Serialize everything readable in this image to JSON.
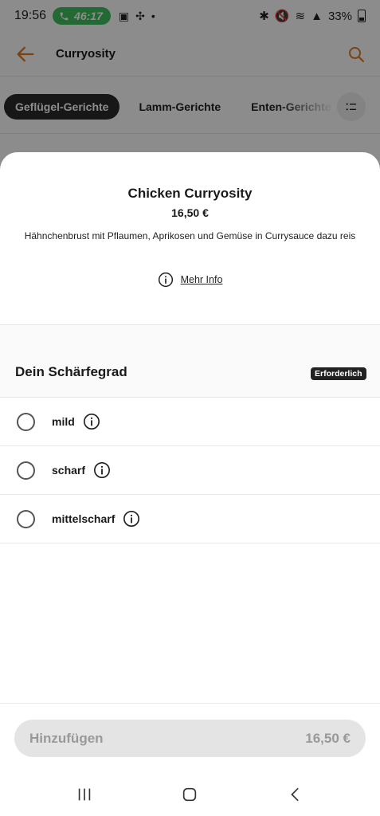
{
  "status_bar": {
    "time": "19:56",
    "call_duration": "46:17",
    "battery": "33%"
  },
  "header": {
    "title": "Curryosity",
    "back_icon": "back-arrow-icon",
    "search_icon": "search-icon"
  },
  "categories": {
    "items": [
      "Geflügel-Gerichte",
      "Lamm-Gerichte",
      "Enten-Gerichte"
    ],
    "active_index": 0,
    "list_icon": "list-icon"
  },
  "product": {
    "name": "Chicken Curryosity",
    "price": "16,50 €",
    "description": "Hähnchenbrust mit Pflaumen, Aprikosen und Gemüse in Currysauce dazu reis",
    "more_info_label": "Mehr Info"
  },
  "spice_section": {
    "title": "Dein Schärfegrad",
    "badge": "Erforderlich",
    "options": [
      {
        "label": "mild"
      },
      {
        "label": "scharf"
      },
      {
        "label": "mittelscharf"
      }
    ]
  },
  "add_button": {
    "label": "Hinzufügen",
    "price": "16,50 €"
  },
  "colors": {
    "accent": "#e07a1f",
    "call_green": "#3fbf5f",
    "chip_dark": "#2a2a2a"
  }
}
